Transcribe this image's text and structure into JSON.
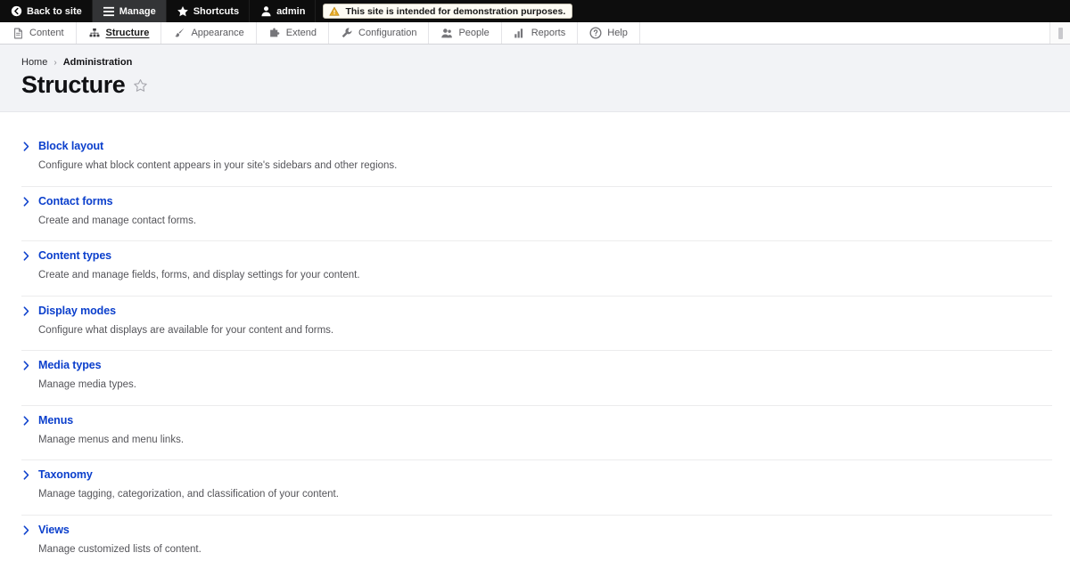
{
  "toolbar": {
    "items": [
      {
        "label": "Back to site",
        "icon": "back-arrow-circle-icon",
        "active": false
      },
      {
        "label": "Manage",
        "icon": "hamburger-menu-icon",
        "active": true
      },
      {
        "label": "Shortcuts",
        "icon": "star-icon",
        "active": false
      },
      {
        "label": "admin",
        "icon": "user-account-icon",
        "active": false
      }
    ],
    "notice": {
      "text": "This site is intended for demonstration purposes.",
      "icon": "warning-triangle-icon"
    }
  },
  "admin_nav": {
    "items": [
      {
        "label": "Content",
        "icon": "document-icon",
        "active": false
      },
      {
        "label": "Structure",
        "icon": "sitemap-icon",
        "active": true
      },
      {
        "label": "Appearance",
        "icon": "paintbrush-icon",
        "active": false
      },
      {
        "label": "Extend",
        "icon": "puzzle-piece-icon",
        "active": false
      },
      {
        "label": "Configuration",
        "icon": "wrench-icon",
        "active": false
      },
      {
        "label": "People",
        "icon": "people-icon",
        "active": false
      },
      {
        "label": "Reports",
        "icon": "bar-chart-icon",
        "active": false
      },
      {
        "label": "Help",
        "icon": "question-mark-icon",
        "active": false
      }
    ]
  },
  "header": {
    "breadcrumb": [
      {
        "label": "Home",
        "current": false
      },
      {
        "label": "Administration",
        "current": true
      }
    ],
    "breadcrumb_separator": "›",
    "title": "Structure",
    "bookmark_icon": "star-outline-icon"
  },
  "structure_items": [
    {
      "title": "Block layout",
      "description": "Configure what block content appears in your site's sidebars and other regions."
    },
    {
      "title": "Contact forms",
      "description": "Create and manage contact forms."
    },
    {
      "title": "Content types",
      "description": "Create and manage fields, forms, and display settings for your content."
    },
    {
      "title": "Display modes",
      "description": "Configure what displays are available for your content and forms."
    },
    {
      "title": "Media types",
      "description": "Manage media types."
    },
    {
      "title": "Menus",
      "description": "Manage menus and menu links."
    },
    {
      "title": "Taxonomy",
      "description": "Manage tagging, categorization, and classification of your content."
    },
    {
      "title": "Views",
      "description": "Manage customized lists of content."
    }
  ],
  "colors": {
    "toolbar_bg": "#0d0d0d",
    "toolbar_active_bg": "#333436",
    "link_blue": "#0b3fcc",
    "header_band": "#f2f3f6",
    "notice_bg": "#fdfbf3",
    "warning_amber": "#e5a823"
  }
}
